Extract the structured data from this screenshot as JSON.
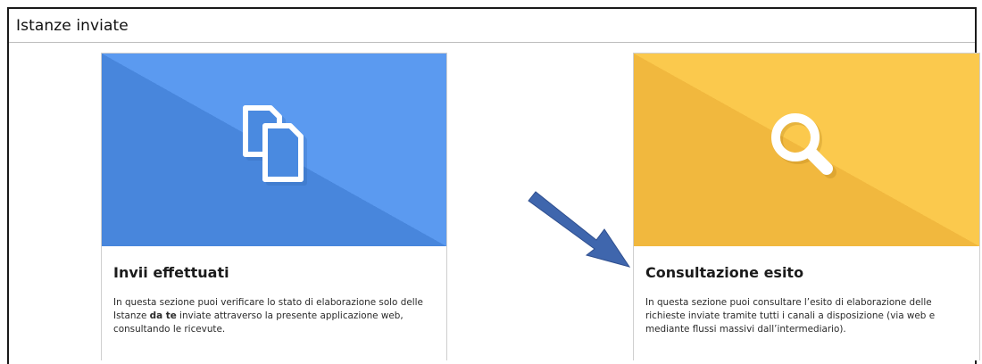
{
  "page": {
    "title": "Istanze inviate"
  },
  "cards": [
    {
      "title": "Invii effettuati",
      "description_parts": [
        "In questa sezione puoi verificare lo stato di elaborazione solo delle Istanze ",
        "da te",
        " inviate attraverso la presente applicazione web, consultando le ricevute."
      ],
      "icon": "documents-icon",
      "color": "#4a8ae0"
    },
    {
      "title": "Consultazione esito",
      "description": "In questa sezione puoi consultare l’esito di elaborazione delle richieste inviate tramite tutti i canali a disposizione (via web e mediante flussi massivi dall’intermediario).",
      "icon": "search-icon",
      "color": "#f6c047"
    }
  ],
  "annotation": {
    "icon": "arrow-icon",
    "color": "#3f66ad"
  }
}
